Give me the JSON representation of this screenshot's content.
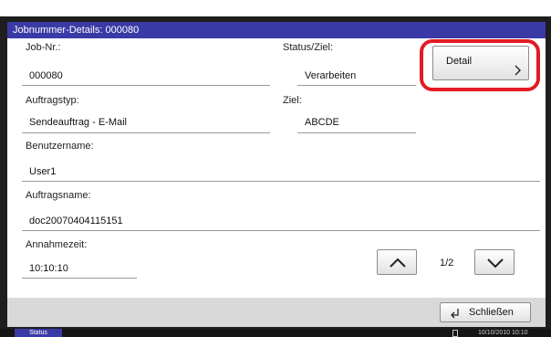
{
  "title": "Jobnummer-Details: 000080",
  "fields": {
    "job_nr": {
      "label": "Job-Nr.:",
      "value": "000080"
    },
    "status": {
      "label": "Status/Ziel:",
      "value": "Verarbeiten"
    },
    "auftragstyp": {
      "label": "Auftragstyp:",
      "value": "Sendeauftrag - E-Mail"
    },
    "ziel": {
      "label": "Ziel:",
      "value": "ABCDE"
    },
    "benutzername": {
      "label": "Benutzername:",
      "value": "User1"
    },
    "auftragsname": {
      "label": "Auftragsname:",
      "value": "doc20070404115151"
    },
    "annahmezeit": {
      "label": "Annahmezeit:",
      "value": "10:10:10"
    }
  },
  "detail_button": {
    "label": "Detail",
    "icon": "chevron-right-icon"
  },
  "pager": {
    "page": "1/2",
    "up_icon": "chevron-up-icon",
    "down_icon": "chevron-down-icon"
  },
  "close_button": {
    "label": "Schließen",
    "icon": "return-arrow-icon"
  },
  "statusbar": {
    "status_tab": "Status",
    "datetime": "10/10/2010  10:10"
  },
  "colors": {
    "title_bar": "#3a3aa6",
    "highlight": "#e21b24",
    "frame": "#1e1e1e"
  }
}
